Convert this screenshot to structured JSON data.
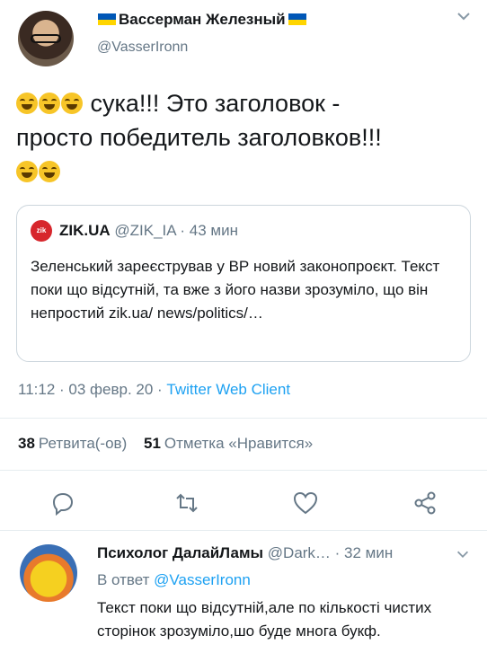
{
  "tweet": {
    "author_name": "Вассерман Железный",
    "author_handle": "@VasserIronn",
    "text_lines": [
      " сука!!! Это заголовок -",
      "просто победитель заголовков!!!"
    ],
    "emoji_name": "rolling-on-floor-laughing",
    "timestamp": "11:12 · 03 февр. 20 · ",
    "client": "Twitter Web Client",
    "retweets_count": "38",
    "retweets_label": "Ретвита(-ов)",
    "likes_count": "51",
    "likes_label": "Отметка «Нравится»"
  },
  "quoted": {
    "logo_text": "zik",
    "name": "ZIK.UA",
    "meta": " @ZIK_IA · 43 мин",
    "text": "Зеленський зареєстрував у ВР новий законопроєкт. Текст поки що відсутній, та вже з його назви зрозуміло, що він непростий zik.ua/ news/politics/…"
  },
  "reply": {
    "author_name": "Психолог ДалайЛамы",
    "meta": " @Dark… · 32 мин",
    "reply_prefix": "В ответ ",
    "reply_to": "@VasserIronn",
    "text": "Текст поки що відсутній,але по кількості чистих сторінок зрозуміло,шо буде многа букф."
  },
  "icons": [
    "reply-icon",
    "retweet-icon",
    "like-icon",
    "share-icon",
    "chevron-down-icon"
  ],
  "colors": {
    "link": "#1da1f2",
    "muted": "#657786",
    "flag_blue": "#0057b7",
    "flag_yellow": "#ffd500",
    "zik_red": "#d7262c"
  }
}
